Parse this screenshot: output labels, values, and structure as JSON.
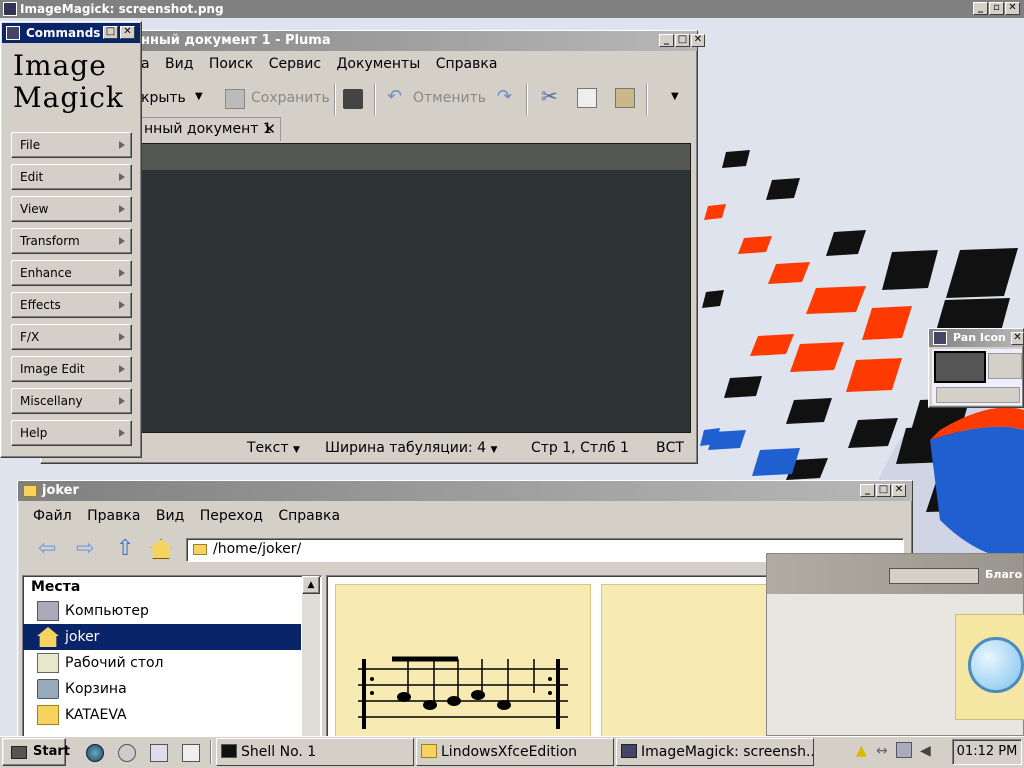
{
  "desktop": {
    "title": "ImageMagick: screenshot.png"
  },
  "pluma": {
    "title": "нный документ 1 - Pluma",
    "menu": [
      "а",
      "Вид",
      "Поиск",
      "Сервис",
      "Документы",
      "Справка"
    ],
    "toolbar": {
      "open": "крыть",
      "save": "Сохранить",
      "undo": "Отменить"
    },
    "tab": "нный документ 1",
    "status": {
      "lang": "Текст",
      "tabwidth": "Ширина табуляции:  4",
      "pos": "Стр 1, Стлб 1",
      "mode": "ВСТ"
    }
  },
  "commands": {
    "title": "Commands",
    "logo": [
      "Image",
      "Magick"
    ],
    "items": [
      "File",
      "Edit",
      "View",
      "Transform",
      "Enhance",
      "Effects",
      "F/X",
      "Image Edit",
      "Miscellany",
      "Help"
    ]
  },
  "joker": {
    "title": "joker",
    "menu": [
      "Файл",
      "Правка",
      "Вид",
      "Переход",
      "Справка"
    ],
    "path": "/home/joker/",
    "places_header": "Места",
    "places": [
      "Компьютер",
      "joker",
      "Рабочий стол",
      "Корзина",
      "KATAEVA"
    ],
    "selected_place": 1
  },
  "pan": {
    "title": "Pan Icon"
  },
  "welcome": {
    "text": "Благо"
  },
  "taskbar": {
    "start": "Start",
    "tasks": [
      "Shell No. 1",
      "LindowsXfceEdition",
      "ImageMagick: screensh..."
    ],
    "clock": "01:12 PM"
  },
  "colors": {
    "wallpaper": "#dfe3ee",
    "accent_orange": "#ff4400",
    "selection": "#0a246a"
  }
}
